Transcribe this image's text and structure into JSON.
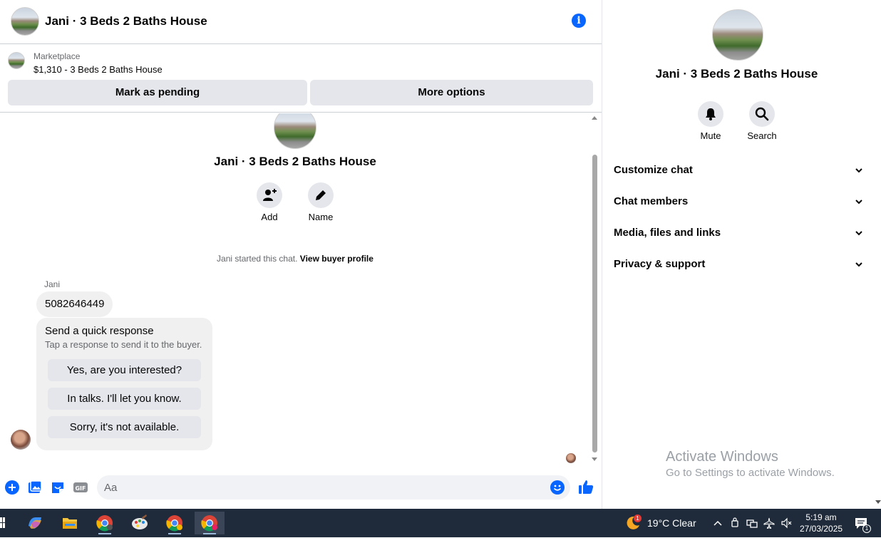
{
  "header": {
    "title": "Jani · 3 Beds 2 Baths House"
  },
  "marketplace": {
    "label": "Marketplace",
    "listing": "$1,310 - 3 Beds 2 Baths House",
    "mark_pending": "Mark as pending",
    "more_options": "More options"
  },
  "conversation": {
    "title": "Jani · 3 Beds 2 Baths House",
    "add_label": "Add",
    "name_label": "Name",
    "started_text": "Jani started this chat.",
    "view_profile": "View buyer profile",
    "sender": "Jani",
    "message": "5082646449",
    "quick": {
      "heading": "Send a quick response",
      "subtext": "Tap a response to send it to the buyer.",
      "options": [
        "Yes, are you interested?",
        "In talks. I'll let you know.",
        "Sorry, it's not available."
      ]
    }
  },
  "composer": {
    "placeholder": "Aa"
  },
  "sidebar": {
    "title": "Jani · 3 Beds 2 Baths House",
    "mute_label": "Mute",
    "search_label": "Search",
    "sections": [
      "Customize chat",
      "Chat members",
      "Media, files and links",
      "Privacy & support"
    ]
  },
  "watermark": {
    "line1": "Activate Windows",
    "line2": "Go to Settings to activate Windows."
  },
  "taskbar": {
    "weather": "19°C Clear",
    "weather_badge": "1",
    "time": "5:19 am",
    "date": "27/03/2025"
  },
  "colors": {
    "accent": "#0866ff",
    "button_gray": "#e4e6eb",
    "bubble": "#f0f0f0",
    "taskbar": "#1f2b3a"
  }
}
